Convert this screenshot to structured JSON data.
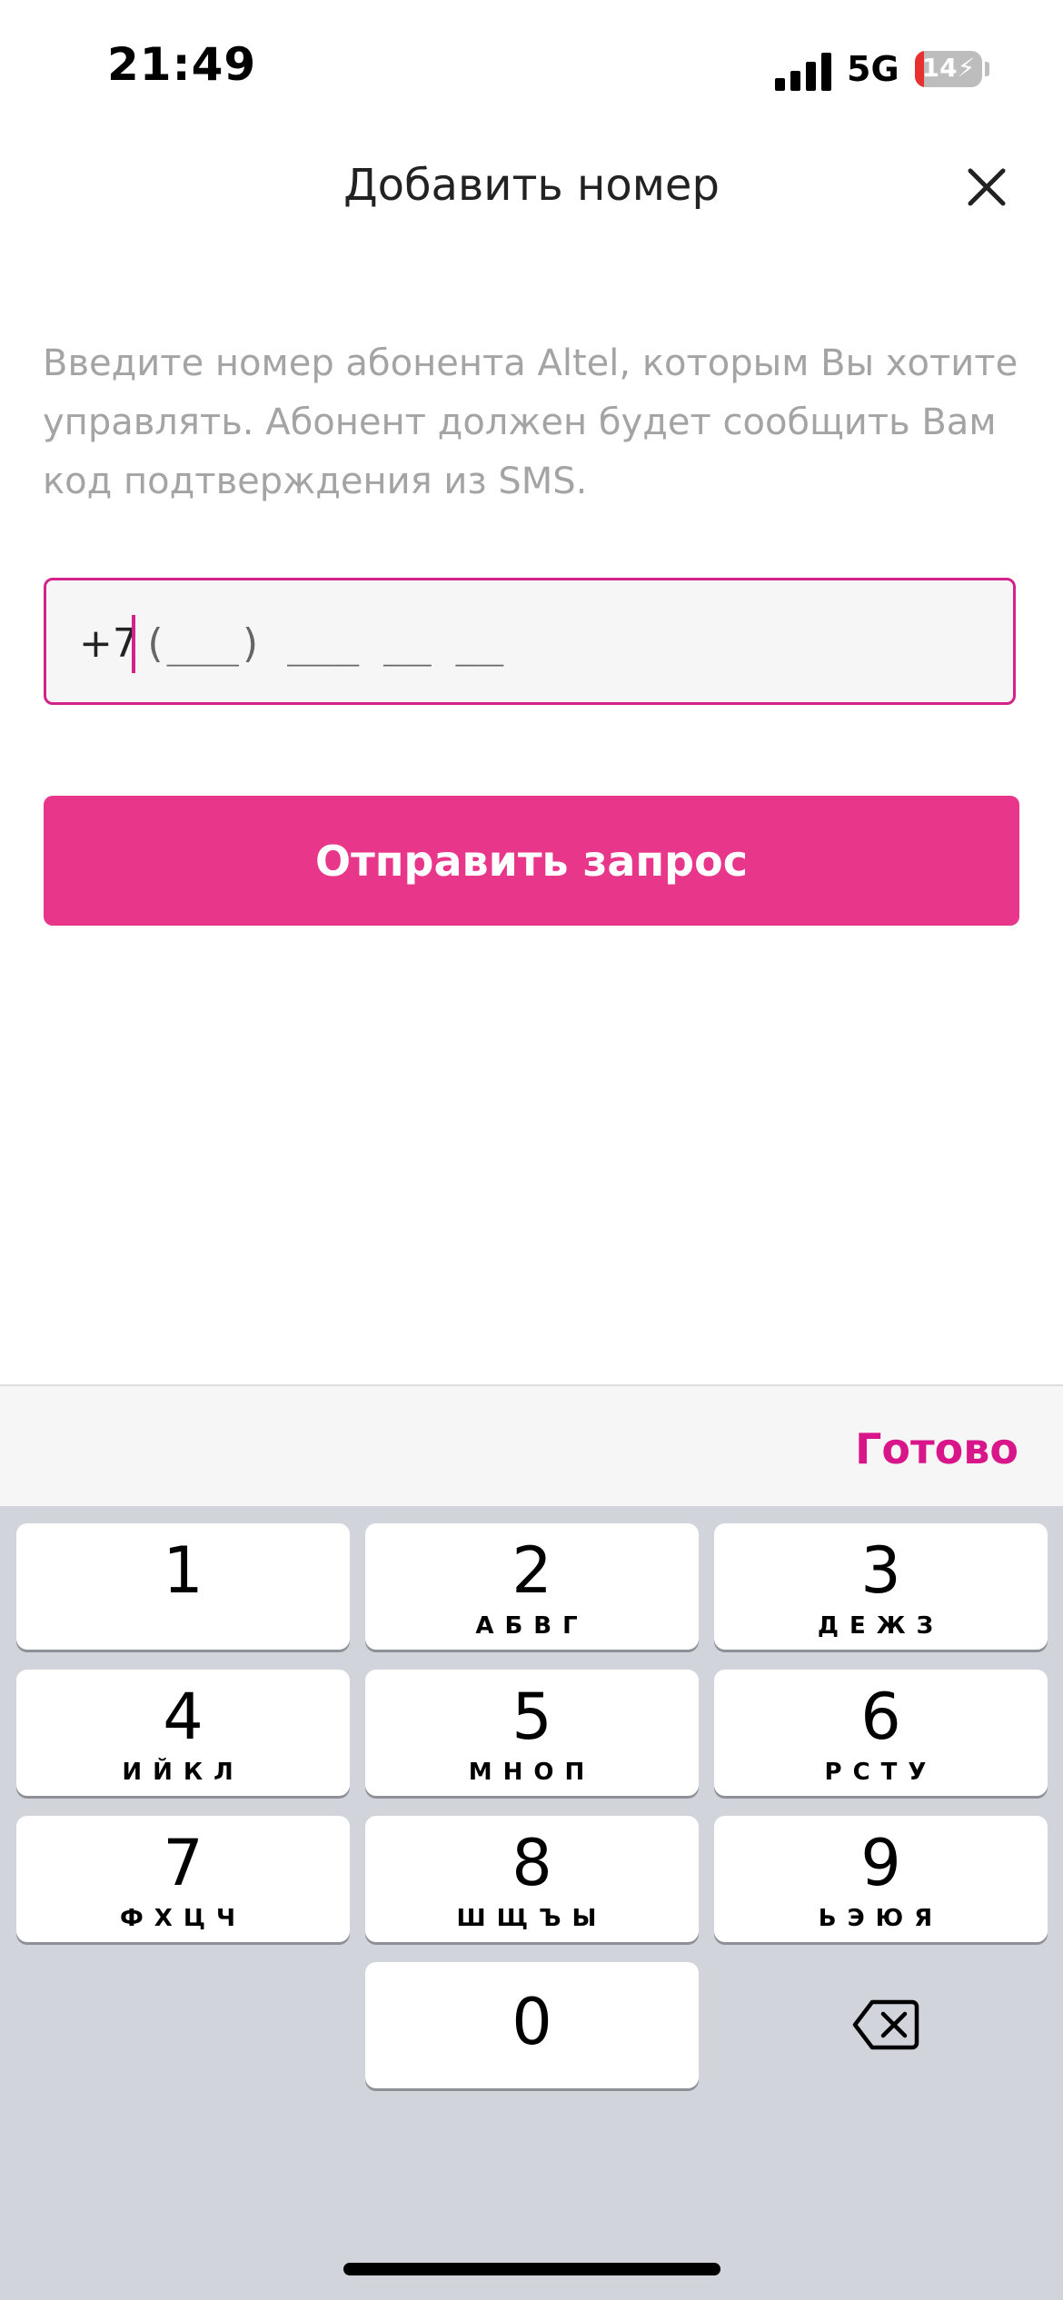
{
  "status_bar": {
    "time": "21:49",
    "network": "5G",
    "battery_level": "14",
    "battery_fraction": 0.14,
    "battery_color": "#e8312f"
  },
  "header": {
    "title": "Добавить номер",
    "close_icon": "close-icon"
  },
  "description": "Введите номер абонента Altel, которым Вы хотите управлять. Абонент должен будет сообщить Вам код подтверждения из SMS.",
  "phone_input": {
    "prefix": "+7",
    "mask": "(___) ___ __ __",
    "border_color": "#d1238a"
  },
  "submit_button": {
    "label": "Отправить запрос",
    "color": "#e8378a"
  },
  "keyboard": {
    "done_label": "Готово",
    "done_color": "#d8168a",
    "keys": [
      {
        "digit": "1",
        "letters": ""
      },
      {
        "digit": "2",
        "letters": "АБВГ"
      },
      {
        "digit": "3",
        "letters": "ДЕЖЗ"
      },
      {
        "digit": "4",
        "letters": "ИЙКЛ"
      },
      {
        "digit": "5",
        "letters": "МНОП"
      },
      {
        "digit": "6",
        "letters": "РСТУ"
      },
      {
        "digit": "7",
        "letters": "ФХЦЧ"
      },
      {
        "digit": "8",
        "letters": "ШЩЪЫ"
      },
      {
        "digit": "9",
        "letters": "ЬЭЮЯ"
      },
      {
        "digit": "0",
        "letters": ""
      }
    ],
    "backspace_icon": "backspace-icon"
  }
}
